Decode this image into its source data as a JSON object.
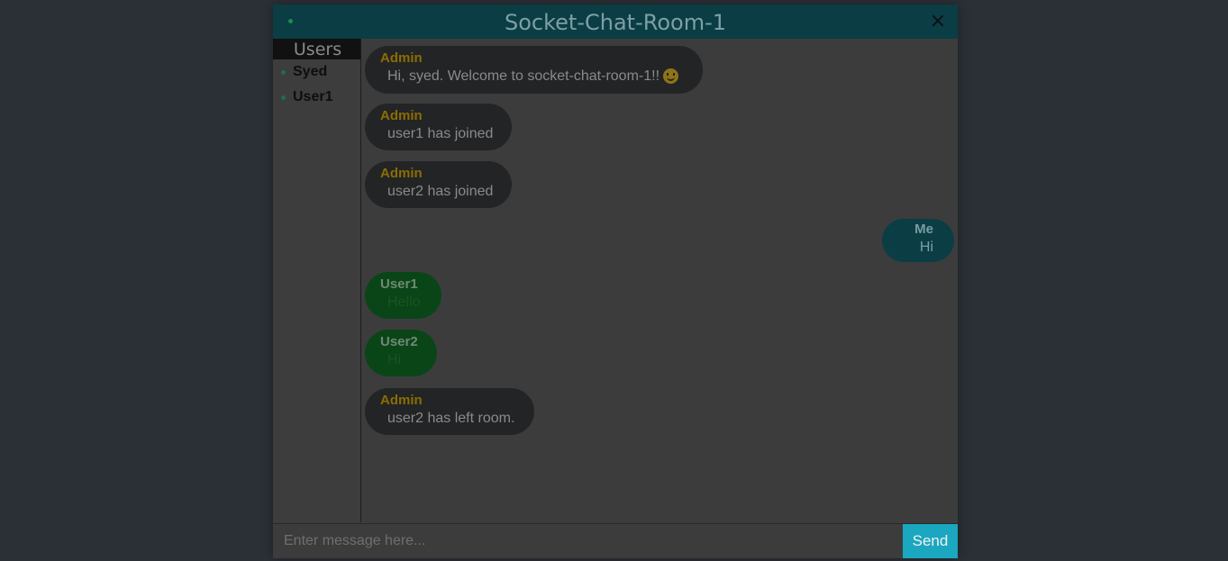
{
  "header": {
    "title": "Socket-Chat-Room-1",
    "close_label": "×"
  },
  "sidebar": {
    "title": "Users",
    "users": [
      {
        "name": "Syed"
      },
      {
        "name": "User1"
      }
    ]
  },
  "messages": [
    {
      "sender": "Admin",
      "text": "Hi, syed. Welcome to socket-chat-room-1!!",
      "emoji": "smiling-face",
      "type": "admin"
    },
    {
      "sender": "Admin",
      "text": "user1 has joined",
      "type": "admin"
    },
    {
      "sender": "Admin",
      "text": "user2 has joined",
      "type": "admin"
    },
    {
      "sender": "Me",
      "text": "Hi",
      "type": "me"
    },
    {
      "sender": "User1",
      "text": "Hello",
      "type": "other"
    },
    {
      "sender": "User2",
      "text": "Hi",
      "type": "other"
    },
    {
      "sender": "Admin",
      "text": "user2 has left room.",
      "type": "admin"
    }
  ],
  "composer": {
    "placeholder": "Enter message here...",
    "value": "",
    "send_label": "Send"
  },
  "colors": {
    "accent": "#1aa7bf",
    "header_bg": "#0b3d45",
    "admin_name": "#8c6d00",
    "other_bubble": "#0a4518"
  }
}
